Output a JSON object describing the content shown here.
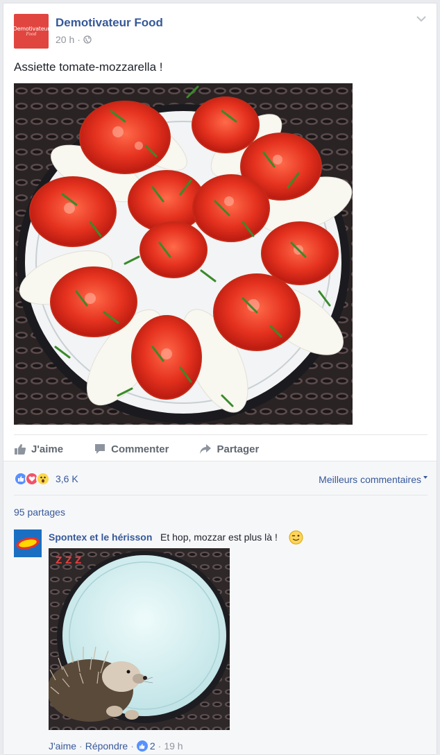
{
  "post": {
    "page_name": "Demotivateur Food",
    "avatar_text": "Demotivateur",
    "avatar_sub": "Food",
    "time": "20 h",
    "dot": "·",
    "privacy_icon": "globe-icon",
    "text": "Assiette tomate-mozzarella !",
    "image_subject": "tomato-mozzarella-plate"
  },
  "actions": {
    "like": "J'aime",
    "comment": "Commenter",
    "share": "Partager"
  },
  "reactions": {
    "types": [
      "like",
      "love",
      "wow"
    ],
    "count": "3,6 K",
    "sort_label": "Meilleurs commentaires"
  },
  "shares": "95 partages",
  "comment": {
    "author": "Spontex et le hérisson",
    "text": "Et hop, mozzar est plus là !",
    "emoji": "wink-emoji",
    "image_subject": "empty-plate-with-hedgehog",
    "image_caption": "Z Z Z",
    "like_label": "J'aime",
    "sep": "·",
    "reply_label": "Répondre",
    "likes": "2",
    "time": "19 h"
  },
  "colors": {
    "link": "#365899",
    "muted": "#90949c",
    "like_blue": "#5890ff",
    "love_red": "#f25268",
    "wow_yellow": "#fcd84a",
    "brand_red": "#e0463f"
  }
}
